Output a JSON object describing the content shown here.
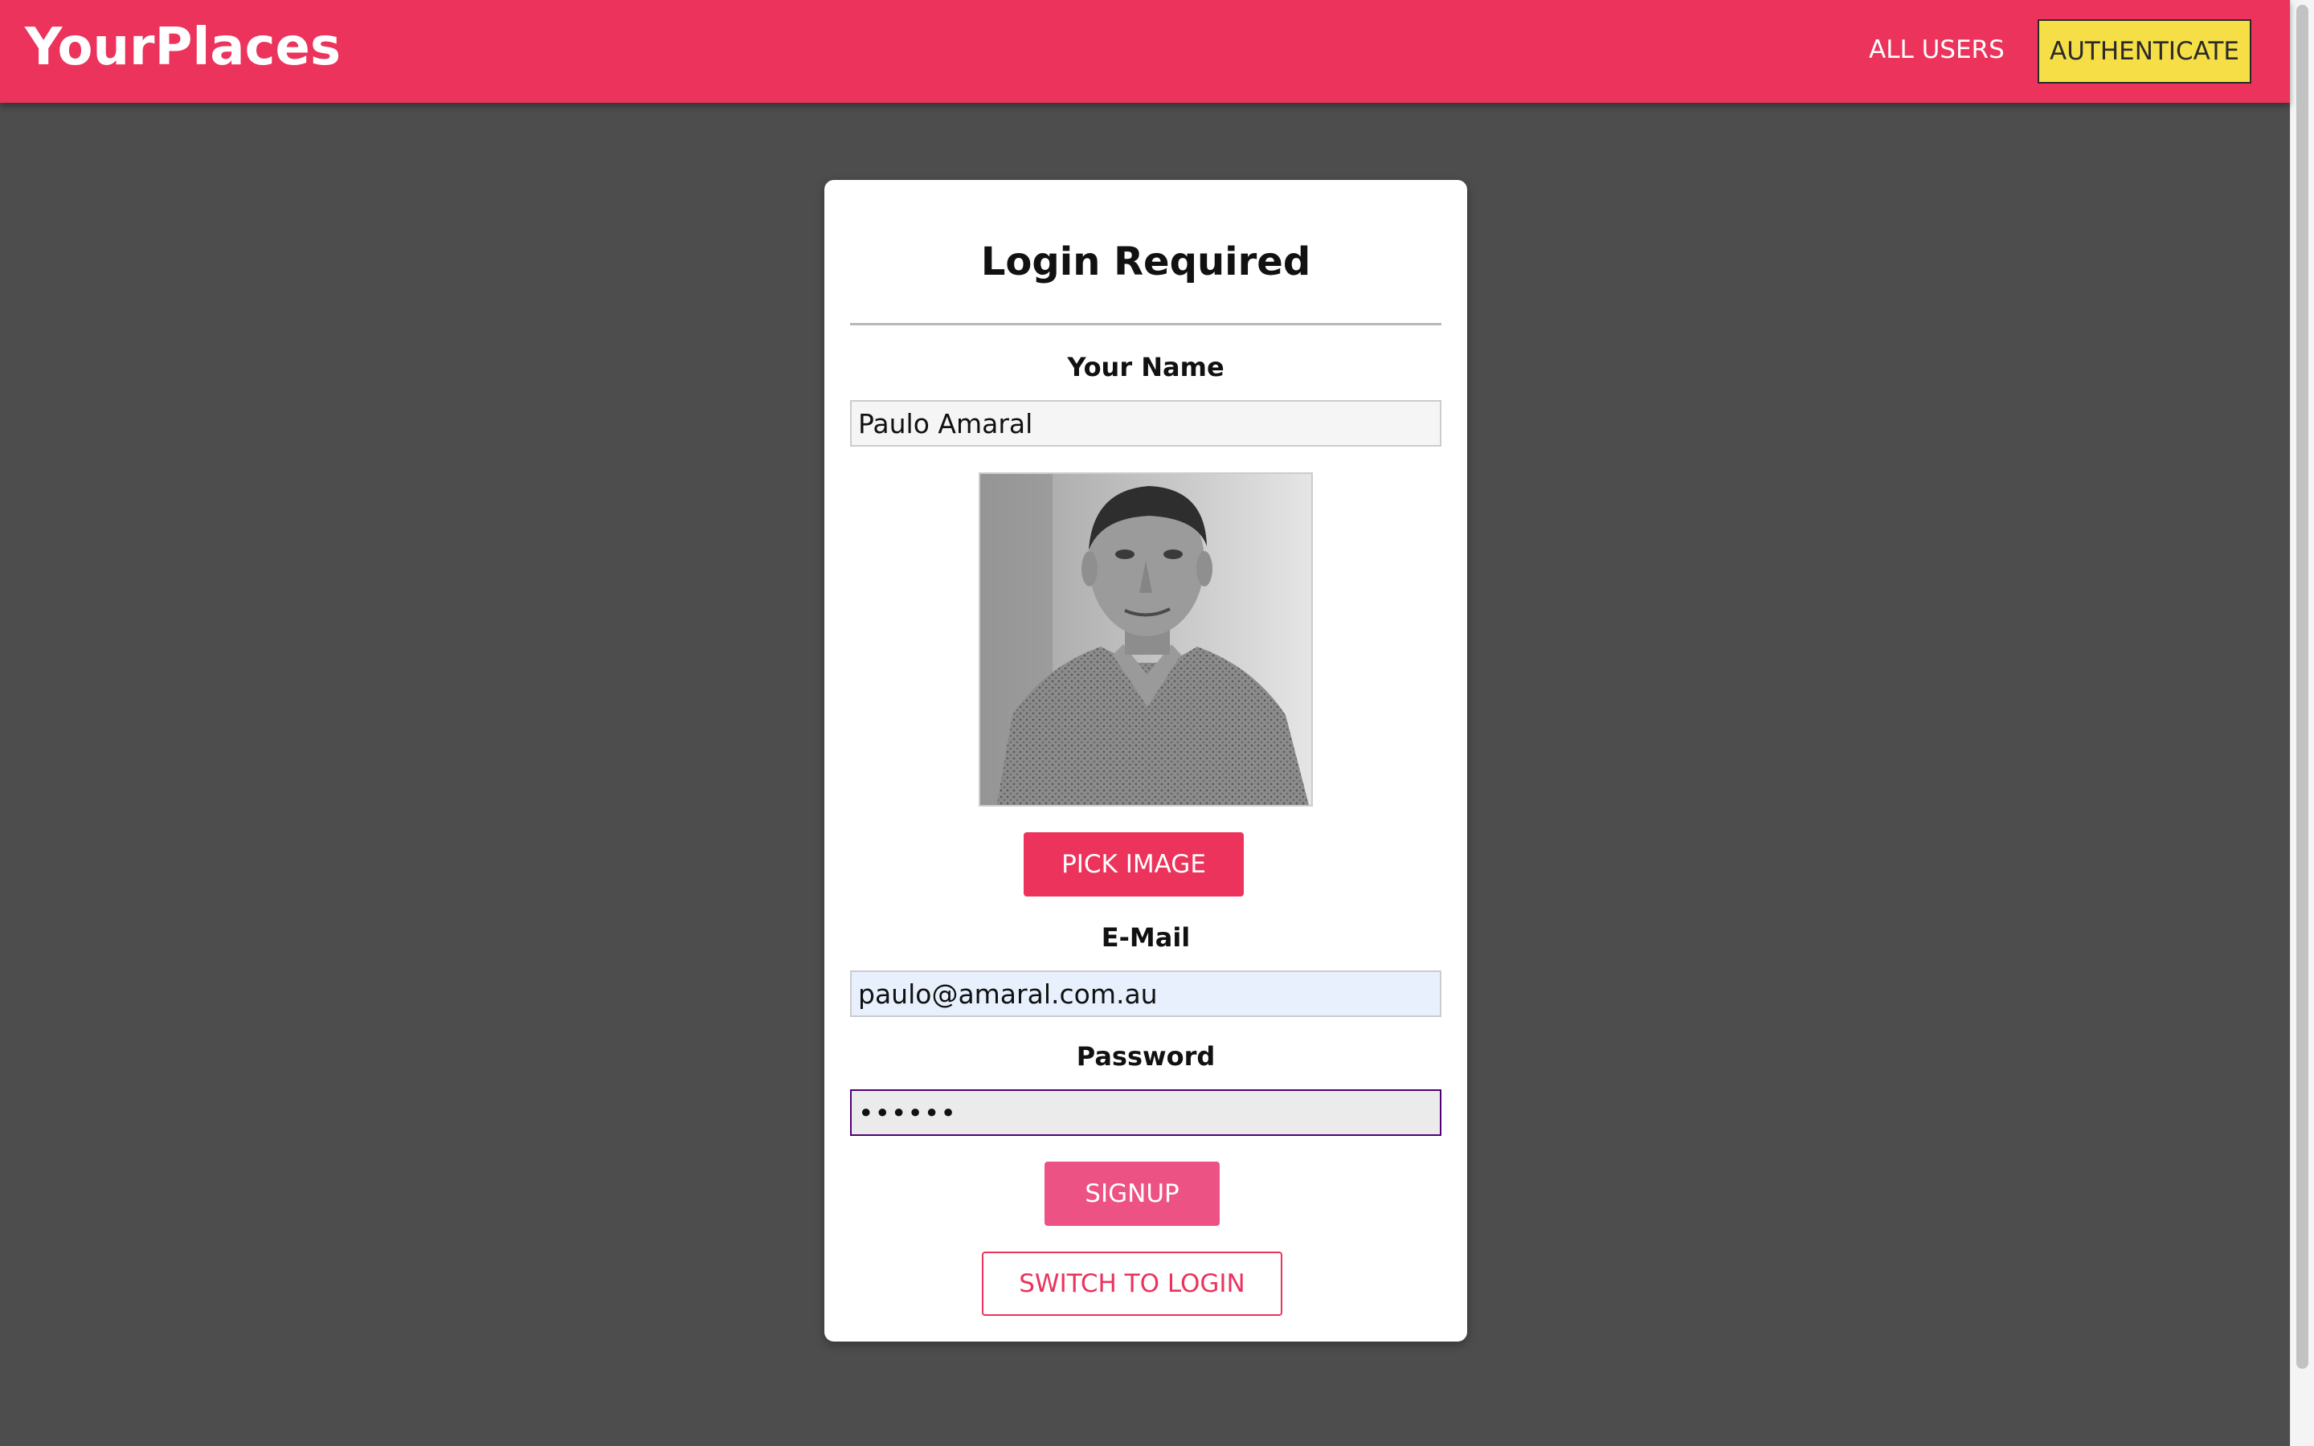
{
  "header": {
    "brand": "YourPlaces",
    "nav": {
      "all_users": "ALL USERS",
      "authenticate": "AUTHENTICATE"
    }
  },
  "auth_card": {
    "title": "Login Required",
    "name_label": "Your Name",
    "name_value": "Paulo Amaral",
    "pick_image_label": "PICK IMAGE",
    "email_label": "E-Mail",
    "email_value": "paulo@amaral.com.au",
    "password_label": "Password",
    "password_value": "••••••",
    "signup_label": "SIGNUP",
    "switch_label": "SWITCH TO LOGIN"
  },
  "colors": {
    "header_bg": "#eb335c",
    "page_bg": "#4d4d4d",
    "auth_button_bg": "#f5de46",
    "primary": "#eb335c",
    "signup": "#ec5283",
    "password_focus_border": "#510077",
    "email_autofill_bg": "#e8f0fe"
  },
  "icons": {
    "profile_image": "person-photo-icon"
  }
}
